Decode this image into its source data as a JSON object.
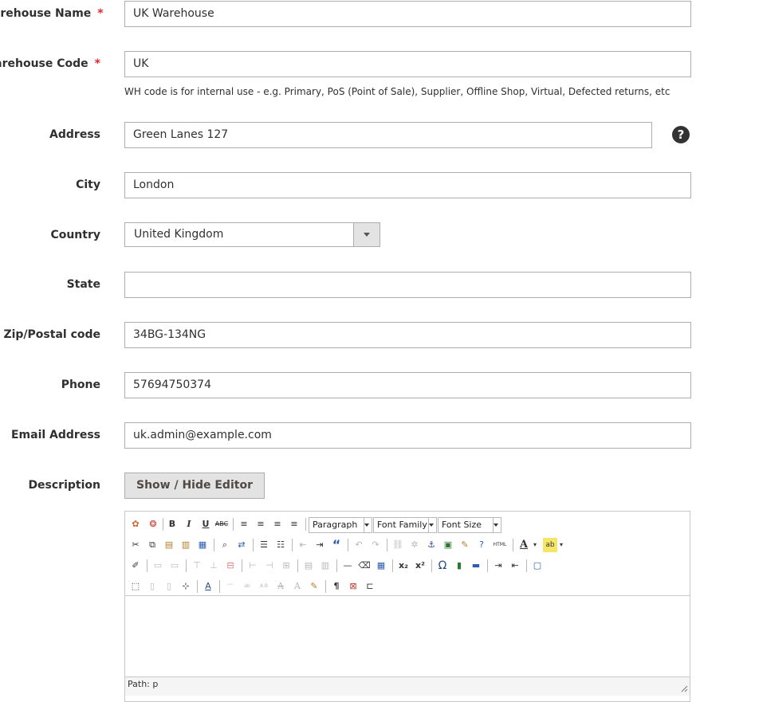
{
  "fields": {
    "warehouse_name": {
      "label": "Warehouse Name",
      "value": "UK Warehouse",
      "required": "*"
    },
    "warehouse_code": {
      "label": "Warehouse Code",
      "value": "UK",
      "required": "*",
      "note": "WH code is for internal use - e.g. Primary, PoS (Point of Sale), Supplier, Offline Shop, Virtual, Defected returns, etc"
    },
    "address": {
      "label": "Address",
      "value": "Green Lanes 127",
      "help": "?"
    },
    "city": {
      "label": "City",
      "value": "London"
    },
    "country": {
      "label": "Country",
      "value": "United Kingdom"
    },
    "state": {
      "label": "State",
      "value": ""
    },
    "zip": {
      "label": "Zip/Postal code",
      "value": "34BG-134NG"
    },
    "phone": {
      "label": "Phone",
      "value": "57694750374"
    },
    "email": {
      "label": "Email Address",
      "value": "uk.admin@example.com"
    },
    "description": {
      "label": "Description",
      "toggle_button": "Show / Hide Editor"
    }
  },
  "editor": {
    "format_select": "Paragraph",
    "font_family_select": "Font Family",
    "font_size_select": "Font Size",
    "status_path": "Path: p",
    "icons": {
      "bold": "B",
      "italic": "I",
      "underline": "U",
      "strike": "ABC",
      "sub": "x₂",
      "sup": "x²",
      "omega": "Ω",
      "pilcrow": "¶",
      "quote": "“",
      "html": "HTML",
      "font_color": "A",
      "help": "?"
    }
  },
  "colors": {
    "required": "#e22626",
    "border": "#adadad",
    "button_bg": "#e3e3e3"
  }
}
